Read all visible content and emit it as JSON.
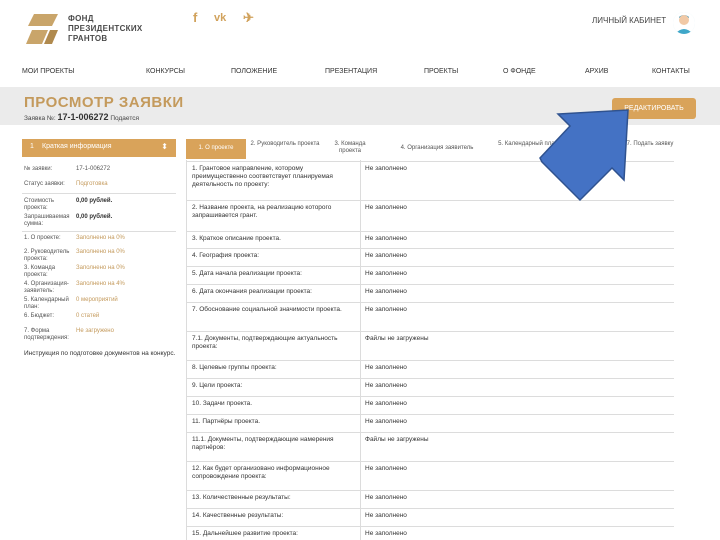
{
  "header": {
    "logo_line1": "ФОНД",
    "logo_line2": "ПРЕЗИДЕНТСКИХ",
    "logo_line3": "ГРАНТОВ",
    "social": {
      "facebook": "f",
      "vk": "vk",
      "telegram": "✈"
    },
    "cabinet_label": "ЛИЧНЫЙ КАБИНЕТ"
  },
  "nav": [
    "МОИ ПРОЕКТЫ",
    "КОНКУРСЫ",
    "ПОЛОЖЕНИЕ",
    "ПРЕЗЕНТАЦИЯ",
    "ПРОЕКТЫ",
    "О ФОНДЕ",
    "АРХИВ",
    "КОНТАКТЫ"
  ],
  "banner": {
    "title": "ПРОСМОТР ЗАЯВКИ",
    "sub_prefix": "Заявка №:",
    "number": "17-1-006272",
    "sub_suffix": "Подается",
    "edit_label": "РЕДАКТИРОВАТЬ"
  },
  "sidebar": {
    "num": "1",
    "title": "Краткая информация",
    "rows": [
      {
        "k": "№ заявки:",
        "v": "17-1-006272",
        "style": ""
      },
      {
        "k": "Статус заявки:",
        "v": "Подготовка",
        "style": "gold"
      },
      {
        "k": "Стоимость проекта:",
        "v": "0,00 рублей.",
        "style": "bold"
      },
      {
        "k": "Запрашиваемая сумма:",
        "v": "0,00 рублей.",
        "style": "bold"
      },
      {
        "k": "1. О проекте:",
        "v": "Заполнено на 0%",
        "style": "gold"
      },
      {
        "k": "2. Руководитель проекта:",
        "v": "Заполнено на 0%",
        "style": "gold"
      },
      {
        "k": "3. Команда проекта:",
        "v": "Заполнено на 0%",
        "style": "gold"
      },
      {
        "k": "4. Организация-заявитель:",
        "v": "Заполнено на 4%",
        "style": "gold"
      },
      {
        "k": "5. Календарный план:",
        "v": "0 мероприятий",
        "style": "gold"
      },
      {
        "k": "6. Бюджет:",
        "v": "0 статей",
        "style": "gold"
      },
      {
        "k": "7. Форма подтверждения:",
        "v": "Не загружено",
        "style": "gold"
      }
    ],
    "instruction": "Инструкция по подготовке документов на конкурс."
  },
  "tabs": [
    "1. О проекте",
    "2. Руководитель проекта",
    "3. Команда проекта",
    "4. Организация заявитель",
    "5. Календарный план",
    "6. Бюджет",
    "7. Подать заявку"
  ],
  "table": [
    {
      "q": "1. Грантовое направление, которому преимущественно соответствует планируемая деятельность по проекту:",
      "a": "Не заполнено"
    },
    {
      "q": "2. Название проекта, на реализацию которого запрашивается грант.",
      "a": "Не заполнено"
    },
    {
      "q": "3. Краткое описание проекта.",
      "a": "Не заполнено"
    },
    {
      "q": "4. География проекта:",
      "a": "Не заполнено"
    },
    {
      "q": "5. Дата начала реализации проекта:",
      "a": "Не заполнено"
    },
    {
      "q": "6. Дата окончания реализации проекта:",
      "a": "Не заполнено"
    },
    {
      "q": "7. Обоснование социальной значимости проекта.",
      "a": "Не заполнено"
    },
    {
      "q": "7.1. Документы, подтверждающие актуальность проекта:",
      "a": "Файлы не загружены"
    },
    {
      "q": "8. Целевые группы проекта:",
      "a": "Не заполнено"
    },
    {
      "q": "9. Цели проекта:",
      "a": "Не заполнено"
    },
    {
      "q": "10. Задачи проекта.",
      "a": "Не заполнено"
    },
    {
      "q": "11. Партнёры проекта.",
      "a": "Не заполнено"
    },
    {
      "q": "11.1. Документы, подтверждающие намерения партнёров:",
      "a": "Файлы не загружены"
    },
    {
      "q": "12. Как будет организовано информационное сопровождение проекта:",
      "a": "Не заполнено"
    },
    {
      "q": "13. Количественные результаты:",
      "a": "Не заполнено"
    },
    {
      "q": "14. Качественные результаты:",
      "a": "Не заполнено"
    },
    {
      "q": "15. Дальнейшее развитие проекта:",
      "a": "Не заполнено"
    }
  ],
  "colors": {
    "accent": "#d9a35a",
    "title": "#c49a5c",
    "arrow": "#4472c4"
  }
}
